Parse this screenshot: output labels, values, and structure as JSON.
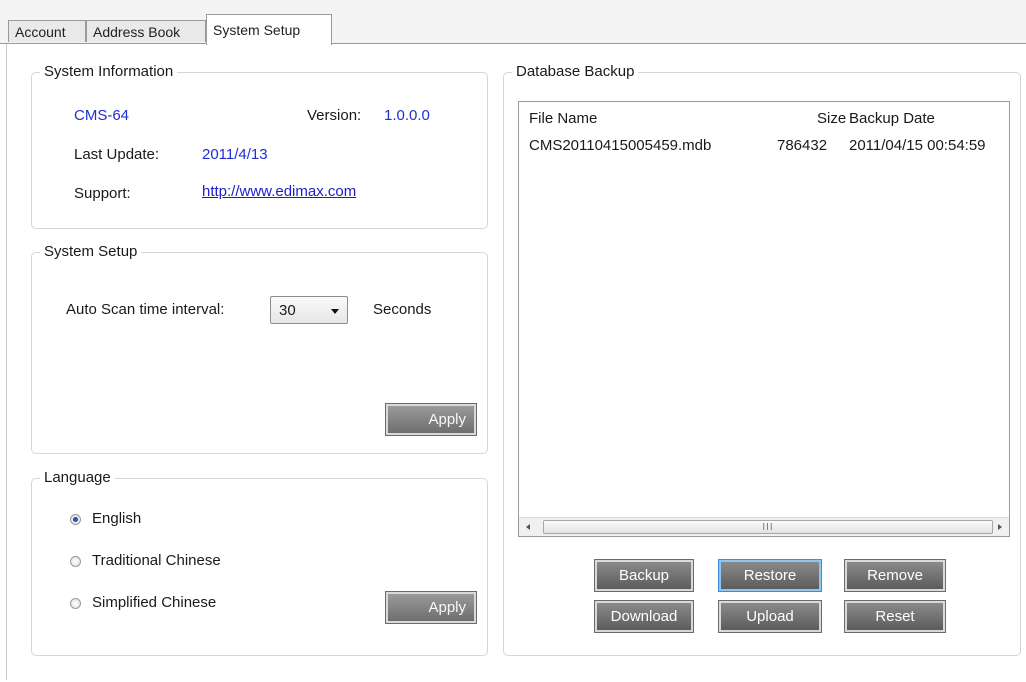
{
  "tabs": [
    "Account",
    "Address Book",
    "System Setup"
  ],
  "active_tab": "System Setup",
  "system_info": {
    "legend": "System Information",
    "model": "CMS-64",
    "version_label": "Version:",
    "version_value": "1.0.0.0",
    "last_update_label": "Last Update:",
    "last_update_value": "2011/4/13",
    "support_label": "Support:",
    "support_link": "http://www.edimax.com"
  },
  "system_setup": {
    "legend": "System Setup",
    "scan_label": "Auto Scan time interval:",
    "scan_value": "30",
    "scan_unit": "Seconds",
    "apply_label": "Apply"
  },
  "language": {
    "legend": "Language",
    "options": [
      "English",
      "Traditional Chinese",
      "Simplified Chinese"
    ],
    "selected": "English",
    "apply_label": "Apply"
  },
  "database_backup": {
    "legend": "Database Backup",
    "columns": [
      "File Name",
      "Size",
      "Backup Date"
    ],
    "rows": [
      {
        "file_name": "CMS20110415005459.mdb",
        "size": "786432",
        "backup_date": "2011/04/15 00:54:59"
      }
    ],
    "buttons": {
      "backup": "Backup",
      "restore": "Restore",
      "remove": "Remove",
      "download": "Download",
      "upload": "Upload",
      "reset": "Reset"
    }
  },
  "colors": {
    "value_blue": "#1f2fd6",
    "button_gray": "#707070"
  }
}
